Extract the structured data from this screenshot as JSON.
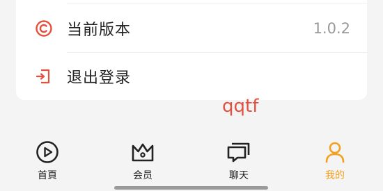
{
  "settings": {
    "rows": [
      {
        "label": "当前版本",
        "value": "1.0.2",
        "icon": "copyright-icon"
      },
      {
        "label": "退出登录",
        "icon": "logout-icon"
      }
    ]
  },
  "watermark": "qqtf",
  "tabbar": {
    "items": [
      {
        "label": "首頁",
        "icon": "play-circle-icon"
      },
      {
        "label": "会员",
        "icon": "crown-icon"
      },
      {
        "label": "聊天",
        "icon": "chat-icon"
      },
      {
        "label": "我的",
        "icon": "user-icon",
        "active": true
      }
    ]
  },
  "colors": {
    "accent_red": "#e4503e",
    "accent_orange": "#f4a01e",
    "text_primary": "#222222",
    "text_secondary": "#999999"
  }
}
